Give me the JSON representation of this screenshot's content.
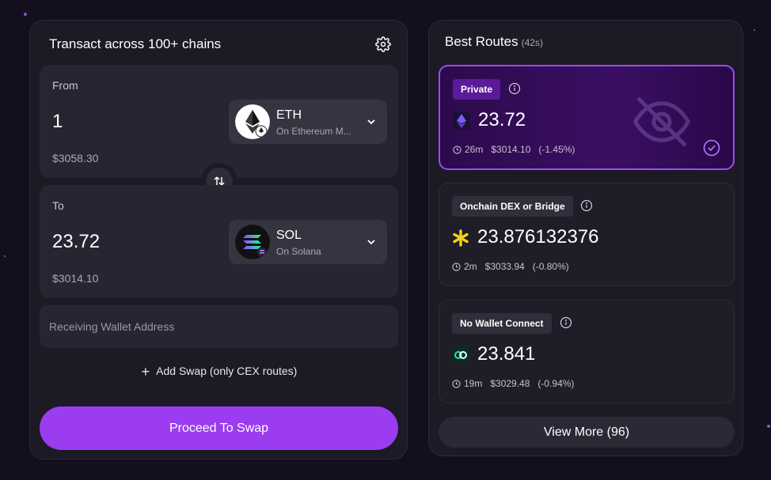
{
  "swap": {
    "title": "Transact across 100+ chains",
    "settings_icon": "gear-icon",
    "from": {
      "label": "From",
      "amount": "1",
      "usd_value": "$3058.30",
      "token": {
        "symbol": "ETH",
        "chain": "On Ethereum M...",
        "icon": "ethereum-icon"
      }
    },
    "to": {
      "label": "To",
      "amount": "23.72",
      "usd_value": "$3014.10",
      "token": {
        "symbol": "SOL",
        "chain": "On Solana",
        "icon": "solana-icon"
      }
    },
    "wallet_placeholder": "Receiving Wallet Address",
    "add_swap_label": "Add Swap (only CEX routes)",
    "proceed_label": "Proceed To Swap"
  },
  "routes": {
    "title": "Best Routes",
    "timer": "(42s)",
    "items": [
      {
        "badge": "Private",
        "amount": "23.72",
        "time": "26m",
        "usd": "$3014.10",
        "change": "(-1.45%)",
        "selected": true
      },
      {
        "badge": "Onchain DEX or Bridge",
        "amount": "23.876132376",
        "time": "2m",
        "usd": "$3033.94",
        "change": "(-0.80%)",
        "selected": false
      },
      {
        "badge": "No Wallet Connect",
        "amount": "23.841",
        "time": "19m",
        "usd": "$3029.48",
        "change": "(-0.94%)",
        "selected": false
      }
    ],
    "view_more_label": "View More (96)"
  },
  "colors": {
    "accent": "#9b3cf0",
    "background": "#140f1f",
    "panel": "#1c1a25"
  }
}
